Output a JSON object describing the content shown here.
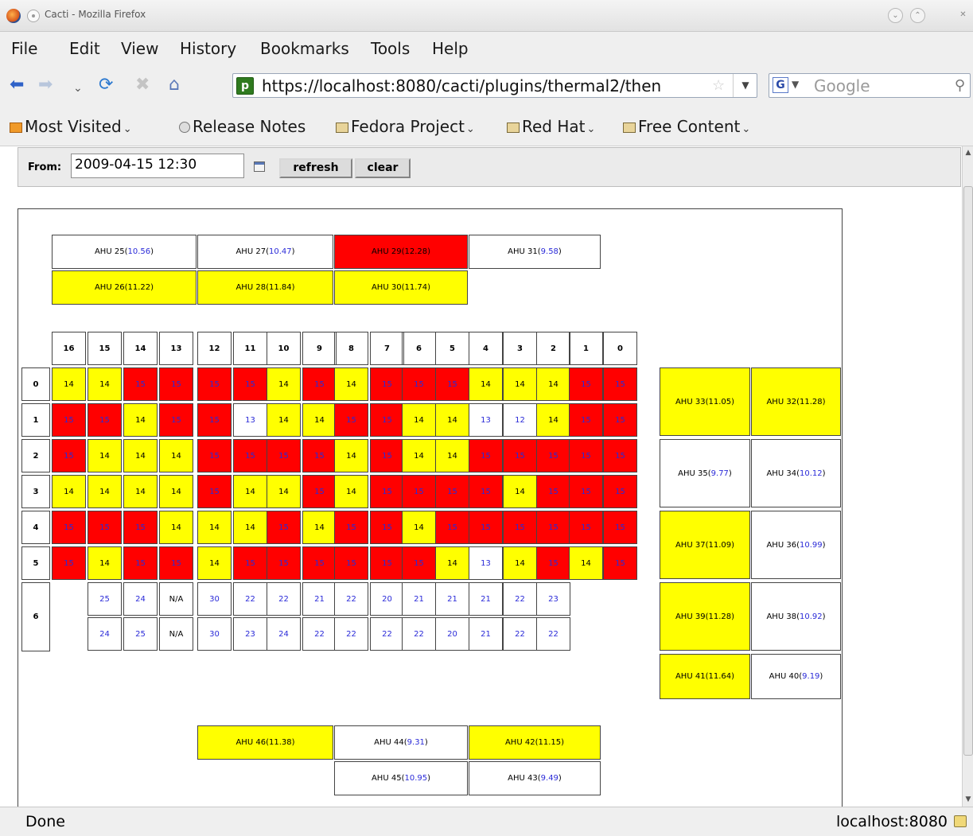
{
  "window": {
    "title": "Cacti - Mozilla Firefox"
  },
  "menu": {
    "items": [
      "File",
      "Edit",
      "View",
      "History",
      "Bookmarks",
      "Tools",
      "Help"
    ]
  },
  "nav": {
    "url": "https://localhost:8080/cacti/plugins/thermal2/then",
    "search_placeholder": "Google"
  },
  "bookmarks": {
    "items": [
      "Most Visited",
      "Release Notes",
      "Fedora Project",
      "Red Hat",
      "Free Content"
    ]
  },
  "filter": {
    "from_label": "From:",
    "from_value": "2009-04-15 12:30",
    "refresh_label": "refresh",
    "clear_label": "clear"
  },
  "colors": {
    "hot": "#ff0000",
    "warm": "#ffff00",
    "normal": "#ffffff",
    "link": "#2a2ad8"
  },
  "ahu_top": [
    {
      "name": "AHU 25",
      "value": "10.56",
      "status": "normal"
    },
    {
      "name": "AHU 27",
      "value": "10.47",
      "status": "normal"
    },
    {
      "name": "AHU 29",
      "value": "12.28",
      "status": "hot"
    },
    {
      "name": "AHU 31",
      "value": "9.58",
      "status": "normal"
    },
    {
      "name": "AHU 26",
      "value": "11.22",
      "status": "warm"
    },
    {
      "name": "AHU 28",
      "value": "11.84",
      "status": "warm"
    },
    {
      "name": "AHU 30",
      "value": "11.74",
      "status": "warm"
    }
  ],
  "ahu_right": [
    {
      "name": "AHU 33",
      "value": "11.05",
      "status": "warm"
    },
    {
      "name": "AHU 32",
      "value": "11.28",
      "status": "warm"
    },
    {
      "name": "AHU 35",
      "value": "9.77",
      "status": "normal"
    },
    {
      "name": "AHU 34",
      "value": "10.12",
      "status": "normal"
    },
    {
      "name": "AHU 37",
      "value": "11.09",
      "status": "warm"
    },
    {
      "name": "AHU 36",
      "value": "10.99",
      "status": "normal"
    },
    {
      "name": "AHU 39",
      "value": "11.28",
      "status": "warm"
    },
    {
      "name": "AHU 38",
      "value": "10.92",
      "status": "normal"
    },
    {
      "name": "AHU 41",
      "value": "11.64",
      "status": "warm"
    },
    {
      "name": "AHU 40",
      "value": "9.19",
      "status": "normal"
    }
  ],
  "ahu_bottom": [
    {
      "name": "AHU 46",
      "value": "11.38",
      "status": "warm"
    },
    {
      "name": "AHU 44",
      "value": "9.31",
      "status": "normal"
    },
    {
      "name": "AHU 42",
      "value": "11.15",
      "status": "warm"
    },
    {
      "name": "AHU 45",
      "value": "10.95",
      "status": "normal"
    },
    {
      "name": "AHU 43",
      "value": "9.49",
      "status": "normal"
    }
  ],
  "grid": {
    "col_headers": [
      "16",
      "15",
      "14",
      "13",
      "12",
      "11",
      "10",
      "9",
      "8",
      "7",
      "6",
      "5",
      "4",
      "3",
      "2",
      "1",
      "0"
    ],
    "row_headers": [
      "0",
      "1",
      "2",
      "3",
      "4",
      "5",
      "6"
    ],
    "rows": [
      [
        "14",
        "14",
        "15",
        "15",
        "15",
        "15",
        "14",
        "15",
        "14",
        "15",
        "15",
        "15",
        "14",
        "14",
        "14",
        "15",
        "15"
      ],
      [
        "15",
        "15",
        "14",
        "15",
        "15",
        "13",
        "14",
        "14",
        "15",
        "15",
        "14",
        "14",
        "13",
        "12",
        "14",
        "15",
        "15"
      ],
      [
        "15",
        "14",
        "14",
        "14",
        "15",
        "15",
        "15",
        "15",
        "14",
        "15",
        "14",
        "14",
        "15",
        "15",
        "15",
        "15",
        "15"
      ],
      [
        "14",
        "14",
        "14",
        "14",
        "15",
        "14",
        "14",
        "15",
        "14",
        "15",
        "15",
        "15",
        "15",
        "14",
        "15",
        "15",
        "15"
      ],
      [
        "15",
        "15",
        "15",
        "14",
        "14",
        "14",
        "15",
        "14",
        "15",
        "15",
        "14",
        "15",
        "15",
        "15",
        "15",
        "15",
        "15"
      ],
      [
        "15",
        "14",
        "15",
        "15",
        "14",
        "15",
        "15",
        "15",
        "15",
        "15",
        "15",
        "14",
        "13",
        "14",
        "15",
        "14",
        "15"
      ]
    ],
    "row6_top": [
      "25",
      "24",
      "N/A",
      "30",
      "22",
      "22",
      "21",
      "22",
      "20",
      "21",
      "21",
      "21",
      "22",
      "23"
    ],
    "row6_bottom": [
      "24",
      "25",
      "N/A",
      "30",
      "23",
      "24",
      "22",
      "22",
      "22",
      "22",
      "20",
      "21",
      "22",
      "22"
    ]
  },
  "status": {
    "text": "Done",
    "host": "localhost:8080"
  }
}
